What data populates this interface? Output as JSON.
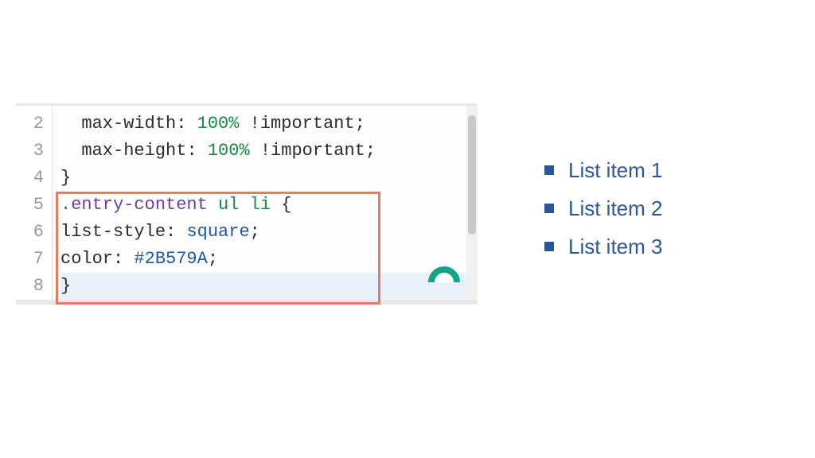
{
  "editor": {
    "line_numbers": [
      "2",
      "3",
      "4",
      "5",
      "6",
      "7",
      "8"
    ],
    "lines": {
      "l2": {
        "indent": "  ",
        "prop": "max-width",
        "colon": ": ",
        "num": "100",
        "pct": "%",
        "sp": " ",
        "imp": "!important",
        "semi": ";"
      },
      "l3": {
        "indent": "  ",
        "prop": "max-height",
        "colon": ": ",
        "num": "100",
        "pct": "%",
        "sp": " ",
        "imp": "!important",
        "semi": ";"
      },
      "l4": {
        "brace": "}"
      },
      "l5": {
        "sel": ".entry-content",
        "sp1": " ",
        "tag1": "ul",
        "sp2": " ",
        "tag2": "li",
        "sp3": " ",
        "brace": "{"
      },
      "l6": {
        "prop": "list-style",
        "colon": ": ",
        "val": "square",
        "semi": ";"
      },
      "l7": {
        "prop": "color",
        "colon": ": ",
        "val": "#2B579A",
        "semi": ";"
      },
      "l8": {
        "brace": "}"
      }
    }
  },
  "preview": {
    "items": [
      "List item 1",
      "List item 2",
      "List item 3"
    ]
  }
}
